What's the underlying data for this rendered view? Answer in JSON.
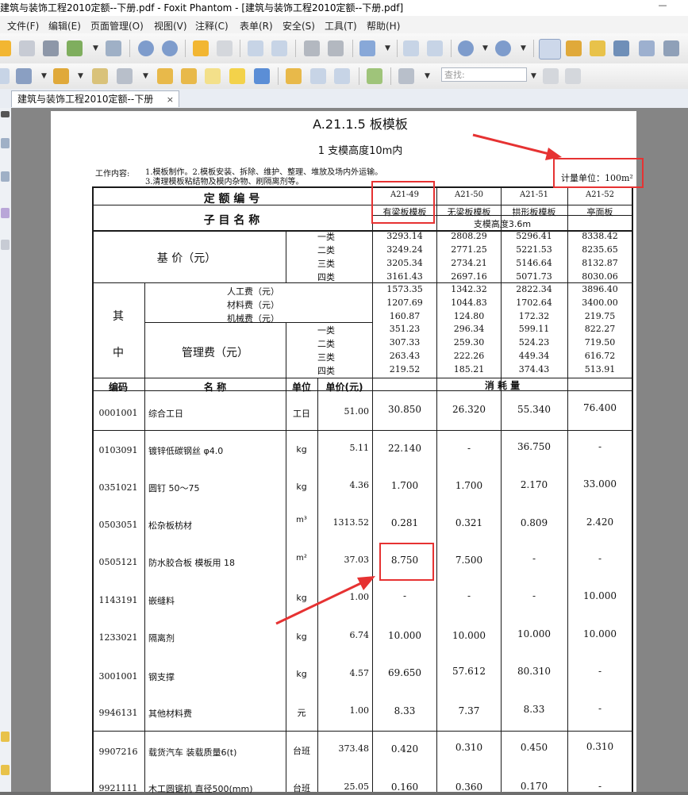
{
  "window": {
    "title": "建筑与装饰工程2010定额--下册.pdf - Foxit Phantom - [建筑与装饰工程2010定额--下册.pdf]",
    "minimize_glyph": "—"
  },
  "menu": [
    "文件(F)",
    "编辑(E)",
    "页面管理(O)",
    "视图(V)",
    "注释(C)",
    "表单(R)",
    "安全(S)",
    "工具(T)",
    "帮助(H)"
  ],
  "toolbar": {
    "search_placeholder": "查找:"
  },
  "tab": {
    "label": "建筑与装饰工程2010定额--下册",
    "close": "×"
  },
  "doc": {
    "section_title": "A.21.1.5  板模板",
    "subtitle": "1  支模高度10m内",
    "work_content_label": "工作内容:",
    "work_content_1": "1.模板制作。2.模板安装、拆除、维护、整理、堆放及场内外运输。",
    "work_content_2": "3.清理模板粘结物及模内杂物、刷隔离剂等。",
    "unit_note": "计量单位：100m²",
    "code_header": "定  额  编  号",
    "name_header": "子 目 名 称",
    "codes": [
      "A21-49",
      "A21-50",
      "A21-51",
      "A21-52"
    ],
    "types": [
      "有梁板模板",
      "无梁板模板",
      "拱形板模板",
      "亭面板"
    ],
    "support_height": "支模高度3.6m",
    "base_price_label": "基 价（元）",
    "grades": [
      "一类",
      "二类",
      "三类",
      "四类"
    ],
    "base_price": [
      [
        "3293.14",
        "2808.29",
        "5296.41",
        "8338.42"
      ],
      [
        "3249.24",
        "2771.25",
        "5221.53",
        "8235.65"
      ],
      [
        "3205.34",
        "2734.21",
        "5146.64",
        "8132.87"
      ],
      [
        "3161.43",
        "2697.16",
        "5071.73",
        "8030.06"
      ]
    ],
    "qi": "其",
    "zhong": "中",
    "cost_items": [
      {
        "label": "人工费（元）",
        "values": [
          "1573.35",
          "1342.32",
          "2822.34",
          "3896.40"
        ]
      },
      {
        "label": "材料费（元）",
        "values": [
          "1207.69",
          "1044.83",
          "1702.64",
          "3400.00"
        ]
      },
      {
        "label": "机械费（元）",
        "values": [
          "160.87",
          "124.80",
          "172.32",
          "219.75"
        ]
      }
    ],
    "mgmt_label": "管理费（元）",
    "mgmt_fee": [
      [
        "351.23",
        "296.34",
        "599.11",
        "822.27"
      ],
      [
        "307.33",
        "259.30",
        "524.23",
        "719.50"
      ],
      [
        "263.43",
        "222.26",
        "449.34",
        "616.72"
      ],
      [
        "219.52",
        "185.21",
        "374.43",
        "513.91"
      ]
    ],
    "col_headers": {
      "code": "编码",
      "name": "名    称",
      "unit": "单位",
      "price": "单价(元)",
      "consumption": "消    耗    量"
    },
    "items": [
      {
        "code": "0001001",
        "name": "综合工日",
        "unit": "工日",
        "price": "51.00",
        "values": [
          "30.850",
          "26.320",
          "55.340",
          "76.400"
        ]
      },
      {
        "code": "0103091",
        "name": "镀锌低碳钢丝  φ4.0",
        "unit": "kg",
        "price": "5.11",
        "values": [
          "22.140",
          "-",
          "36.750",
          "-"
        ]
      },
      {
        "code": "0351021",
        "name": "圆钉  50～75",
        "unit": "kg",
        "price": "4.36",
        "values": [
          "1.700",
          "1.700",
          "2.170",
          "33.000"
        ]
      },
      {
        "code": "0503051",
        "name": "松杂板枋材",
        "unit": "m³",
        "price": "1313.52",
        "values": [
          "0.281",
          "0.321",
          "0.809",
          "2.420"
        ]
      },
      {
        "code": "0505121",
        "name": "防水胶合板  模板用 18",
        "unit": "m²",
        "price": "37.03",
        "values": [
          "8.750",
          "7.500",
          "-",
          "-"
        ]
      },
      {
        "code": "1143191",
        "name": "嵌缝料",
        "unit": "kg",
        "price": "1.00",
        "values": [
          "-",
          "-",
          "-",
          "10.000"
        ]
      },
      {
        "code": "1233021",
        "name": "隔离剂",
        "unit": "kg",
        "price": "6.74",
        "values": [
          "10.000",
          "10.000",
          "10.000",
          "10.000"
        ]
      },
      {
        "code": "3001001",
        "name": "钢支撑",
        "unit": "kg",
        "price": "4.57",
        "values": [
          "69.650",
          "57.612",
          "80.310",
          "-"
        ]
      },
      {
        "code": "9946131",
        "name": "其他材料费",
        "unit": "元",
        "price": "1.00",
        "values": [
          "8.33",
          "7.37",
          "8.33",
          "-"
        ]
      },
      {
        "code": "9907216",
        "name": "载货汽车  装载质量6(t)",
        "unit": "台班",
        "price": "373.48",
        "values": [
          "0.420",
          "0.310",
          "0.450",
          "0.310"
        ]
      },
      {
        "code": "9921111",
        "name": "木工圆锯机  直径500(mm)",
        "unit": "台班",
        "price": "25.05",
        "values": [
          "0.160",
          "0.360",
          "0.170",
          "-"
        ]
      }
    ]
  }
}
